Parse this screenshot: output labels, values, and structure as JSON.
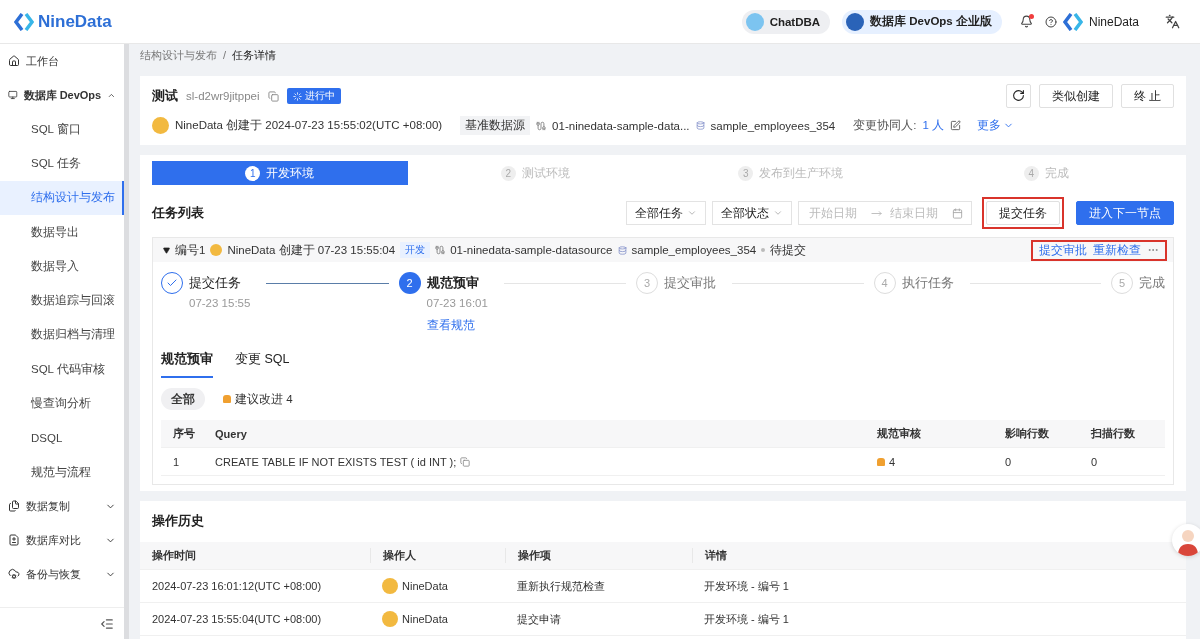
{
  "header": {
    "logo": "NineData",
    "chips": [
      {
        "kind": "chat",
        "label": "ChatDBA"
      },
      {
        "kind": "edition",
        "label": "数据库 DevOps 企业版"
      }
    ],
    "notification": true,
    "user": "NineData"
  },
  "sidebar": {
    "items": [
      {
        "kind": "home",
        "label": "工作台",
        "selected": false
      },
      {
        "kind": "devops",
        "label": "数据库 DevOps",
        "expanded": true,
        "selected": false,
        "children": [
          {
            "label": "SQL 窗口",
            "selected": false
          },
          {
            "label": "SQL 任务",
            "selected": false
          },
          {
            "label": "结构设计与发布",
            "selected": true
          },
          {
            "label": "数据导出",
            "selected": false
          },
          {
            "label": "数据导入",
            "selected": false
          },
          {
            "label": "数据追踪与回滚",
            "selected": false
          },
          {
            "label": "数据归档与清理",
            "selected": false
          },
          {
            "label": "SQL 代码审核",
            "selected": false
          },
          {
            "label": "慢查询分析",
            "selected": false
          },
          {
            "label": "DSQL",
            "selected": false
          },
          {
            "label": "规范与流程",
            "selected": false
          }
        ]
      },
      {
        "kind": "replication",
        "label": "数据复制",
        "expanded": false,
        "selected": false
      },
      {
        "kind": "compare",
        "label": "数据库对比",
        "expanded": false,
        "selected": false
      },
      {
        "kind": "backup",
        "label": "备份与恢复",
        "expanded": false,
        "selected": false
      }
    ]
  },
  "breadcrumb": {
    "separator": "/",
    "items": [
      "结构设计与发布",
      "任务详情"
    ]
  },
  "task": {
    "title": "测试",
    "id": "sl-d2wr9jitppei",
    "status": "进行中",
    "creator": "NineData 创建于 2024-07-23 15:55:02(UTC +08:00)",
    "datasource_label": "基准数据源",
    "datasource": "01-ninedata-sample-data...",
    "database": "sample_employees_354",
    "collaborators_label": "变更协同人:",
    "collaborators": "1 人",
    "more": "更多",
    "buttons": [
      "类似创建",
      "终 止"
    ]
  },
  "stages": [
    {
      "number": "1",
      "label": "开发环境",
      "selected": true
    },
    {
      "number": "2",
      "label": "测试环境",
      "selected": false
    },
    {
      "number": "3",
      "label": "发布到生产环境",
      "selected": false
    },
    {
      "number": "4",
      "label": "完成",
      "selected": false
    }
  ],
  "task_list": {
    "title": "任务列表",
    "filters": [
      "全部任务",
      "全部状态"
    ],
    "start_placeholder": "开始日期",
    "end_placeholder": "结束日期",
    "buttons": [
      {
        "kind": "default",
        "label": "提交任务",
        "highlighted": true
      },
      {
        "kind": "primary",
        "label": "进入下一节点",
        "highlighted": false
      }
    ],
    "item": {
      "number": "编号1",
      "creator": "NineData 创建于 07-23 15:55:04",
      "env": "开发",
      "datasource": "01-ninedata-sample-datasource",
      "database": "sample_employees_354",
      "status": "待提交",
      "expanded": true,
      "actions": [
        "提交审批",
        "重新检查"
      ],
      "actions_highlighted": true,
      "steps": [
        {
          "kind": "done",
          "label": "提交任务",
          "time": "07-23 15:55"
        },
        {
          "kind": "current",
          "number": "2",
          "label": "规范预审",
          "time": "07-23 16:01",
          "link": "查看规范"
        },
        {
          "kind": "pending",
          "number": "3",
          "label": "提交审批"
        },
        {
          "kind": "pending",
          "number": "4",
          "label": "执行任务"
        },
        {
          "kind": "pending",
          "number": "5",
          "label": "完成"
        }
      ],
      "tabs": [
        {
          "label": "规范预审",
          "selected": true
        },
        {
          "label": "变更 SQL",
          "selected": false
        }
      ],
      "chips": [
        {
          "kind": "all",
          "label": "全部",
          "selected": true
        },
        {
          "kind": "warning",
          "label": "建议改进 4",
          "selected": false
        }
      ],
      "columns": [
        "序号",
        "Query",
        "规范审核",
        "影响行数",
        "扫描行数"
      ],
      "rows": [
        {
          "index": "1",
          "query": "CREATE TABLE IF NOT EXISTS TEST ( id INT );",
          "review": "4",
          "affected": "0",
          "scanned": "0"
        }
      ]
    }
  },
  "history": {
    "title": "操作历史",
    "columns": [
      "操作时间",
      "操作人",
      "操作项",
      "详情"
    ],
    "rows": [
      {
        "time": "2024-07-23 16:01:12(UTC +08:00)",
        "operator": "NineData",
        "action": "重新执行规范检查",
        "detail": "开发环境 - 编号 1"
      },
      {
        "time": "2024-07-23 15:55:04(UTC +08:00)",
        "operator": "NineData",
        "action": "提交申请",
        "detail": "开发环境 - 编号 1"
      }
    ]
  }
}
